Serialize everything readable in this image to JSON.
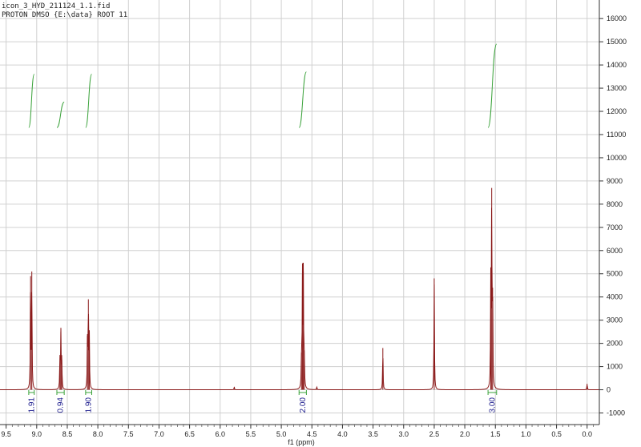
{
  "header": {
    "line1": "icon_3_HYD_211124_1.1.fid",
    "line2": "PROTON DMSO {E:\\data} ROOT 11"
  },
  "chart_data": {
    "type": "line",
    "xlabel": "f1 (ppm)",
    "ylabel": "",
    "xlim": [
      9.6,
      -0.2
    ],
    "ylim": [
      -1500,
      16800
    ],
    "x_ticks": [
      9.5,
      9.0,
      8.5,
      8.0,
      7.5,
      7.0,
      6.5,
      6.0,
      5.5,
      5.0,
      4.5,
      4.0,
      3.5,
      3.0,
      2.5,
      2.0,
      1.5,
      1.0,
      0.5,
      0.0
    ],
    "x_tick_labels": [
      "9.5",
      "9.0",
      "8.5",
      "8.0",
      "7.5",
      "7.0",
      "6.5",
      "6.0",
      "5.5",
      "5.0",
      "4.5",
      "4.0",
      "3.5",
      "3.0",
      "2.5",
      "2.0",
      "1.5",
      "1.0",
      "0.5",
      "0.0"
    ],
    "y_ticks": [
      -1000,
      0,
      1000,
      2000,
      3000,
      4000,
      5000,
      6000,
      7000,
      8000,
      9000,
      10000,
      11000,
      12000,
      13000,
      14000,
      15000,
      16000
    ],
    "y_tick_labels": [
      "-1000",
      "0",
      "1000",
      "2000",
      "3000",
      "4000",
      "5000",
      "6000",
      "7000",
      "8000",
      "9000",
      "10000",
      "11000",
      "12000",
      "13000",
      "14000",
      "15000",
      "16000"
    ],
    "grid": true,
    "colors": {
      "spectrum": "#8b1a1a",
      "integral": "#3aa23a",
      "integral_label": "#1a1a8c",
      "grid": "#d0d0d0",
      "axis": "#333333"
    },
    "peaks": [
      {
        "ppm": 9.1,
        "height": 4900
      },
      {
        "ppm": 9.08,
        "height": 5100
      },
      {
        "ppm": 8.62,
        "height": 1500
      },
      {
        "ppm": 8.605,
        "height": 2500
      },
      {
        "ppm": 8.59,
        "height": 1300
      },
      {
        "ppm": 8.17,
        "height": 2400
      },
      {
        "ppm": 8.155,
        "height": 3900
      },
      {
        "ppm": 8.14,
        "height": 2300
      },
      {
        "ppm": 5.77,
        "height": 120
      },
      {
        "ppm": 4.67,
        "height": 1600
      },
      {
        "ppm": 4.655,
        "height": 5000
      },
      {
        "ppm": 4.64,
        "height": 5100
      },
      {
        "ppm": 4.625,
        "height": 1700
      },
      {
        "ppm": 4.42,
        "height": 120
      },
      {
        "ppm": 3.34,
        "height": 1800
      },
      {
        "ppm": 2.5,
        "height": 4800
      },
      {
        "ppm": 1.575,
        "height": 4500
      },
      {
        "ppm": 1.56,
        "height": 8700
      },
      {
        "ppm": 1.545,
        "height": 4400
      },
      {
        "ppm": 0.0,
        "height": 260
      }
    ],
    "integrals": [
      {
        "from": 9.13,
        "to": 9.04,
        "value": "1.91",
        "y_start": 11300,
        "y_end": 13600
      },
      {
        "from": 8.67,
        "to": 8.55,
        "value": "0.94",
        "y_start": 11300,
        "y_end": 12400
      },
      {
        "from": 8.2,
        "to": 8.1,
        "value": "1.90",
        "y_start": 11300,
        "y_end": 13600
      },
      {
        "from": 4.71,
        "to": 4.59,
        "value": "2.00",
        "y_start": 11300,
        "y_end": 13700
      },
      {
        "from": 1.62,
        "to": 1.48,
        "value": "3.00",
        "y_start": 11300,
        "y_end": 14900
      }
    ]
  }
}
